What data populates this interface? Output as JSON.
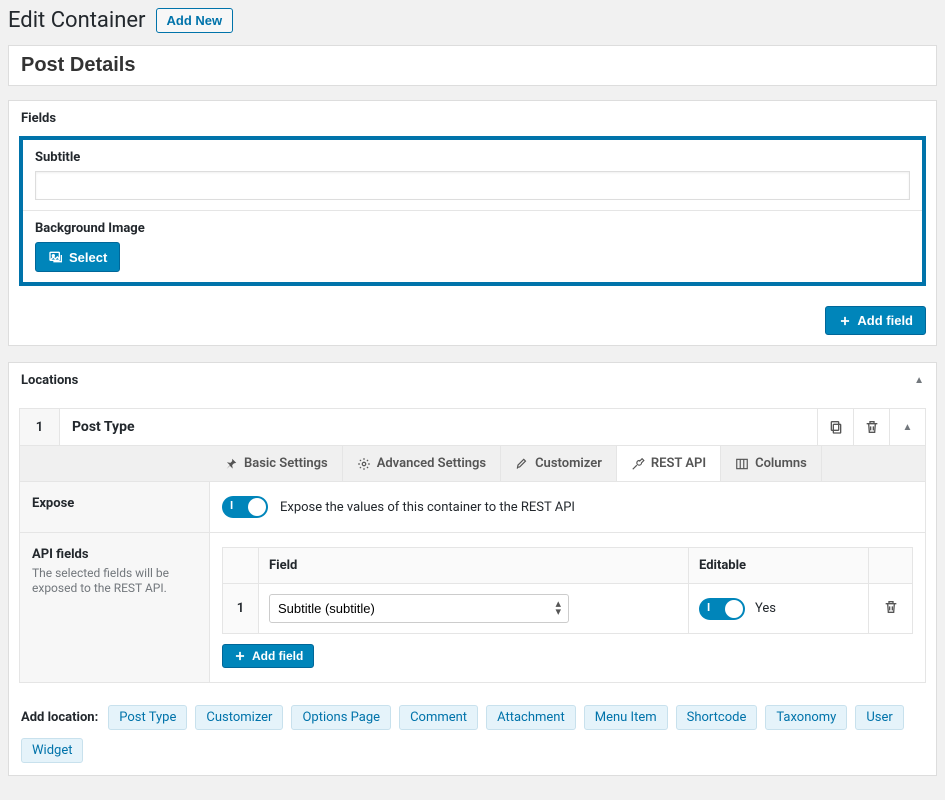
{
  "header": {
    "page_title": "Edit Container",
    "add_new_label": "Add New"
  },
  "container_title": "Post Details",
  "fields_panel": {
    "heading": "Fields",
    "fields": [
      {
        "label": "Subtitle",
        "type": "text",
        "value": ""
      },
      {
        "label": "Background Image",
        "type": "media",
        "button": "Select"
      }
    ],
    "add_field_label": "Add field"
  },
  "locations_panel": {
    "heading": "Locations",
    "row_number": "1",
    "row_title": "Post Type",
    "tabs": [
      "Basic Settings",
      "Advanced Settings",
      "Customizer",
      "REST API",
      "Columns"
    ],
    "active_tab": 3,
    "expose": {
      "label": "Expose",
      "description": "Expose the values of this container to the REST API",
      "on": true
    },
    "api_fields": {
      "label": "API fields",
      "sub": "The selected fields will be exposed to the REST API.",
      "columns": {
        "field": "Field",
        "editable": "Editable"
      },
      "rows": [
        {
          "num": "1",
          "field": "Subtitle (subtitle)",
          "editable_label": "Yes",
          "editable_on": true
        }
      ],
      "add_field_label": "Add field"
    },
    "add_location": {
      "lead": "Add location:",
      "options": [
        "Post Type",
        "Customizer",
        "Options Page",
        "Comment",
        "Attachment",
        "Menu Item",
        "Shortcode",
        "Taxonomy",
        "User",
        "Widget"
      ]
    }
  }
}
